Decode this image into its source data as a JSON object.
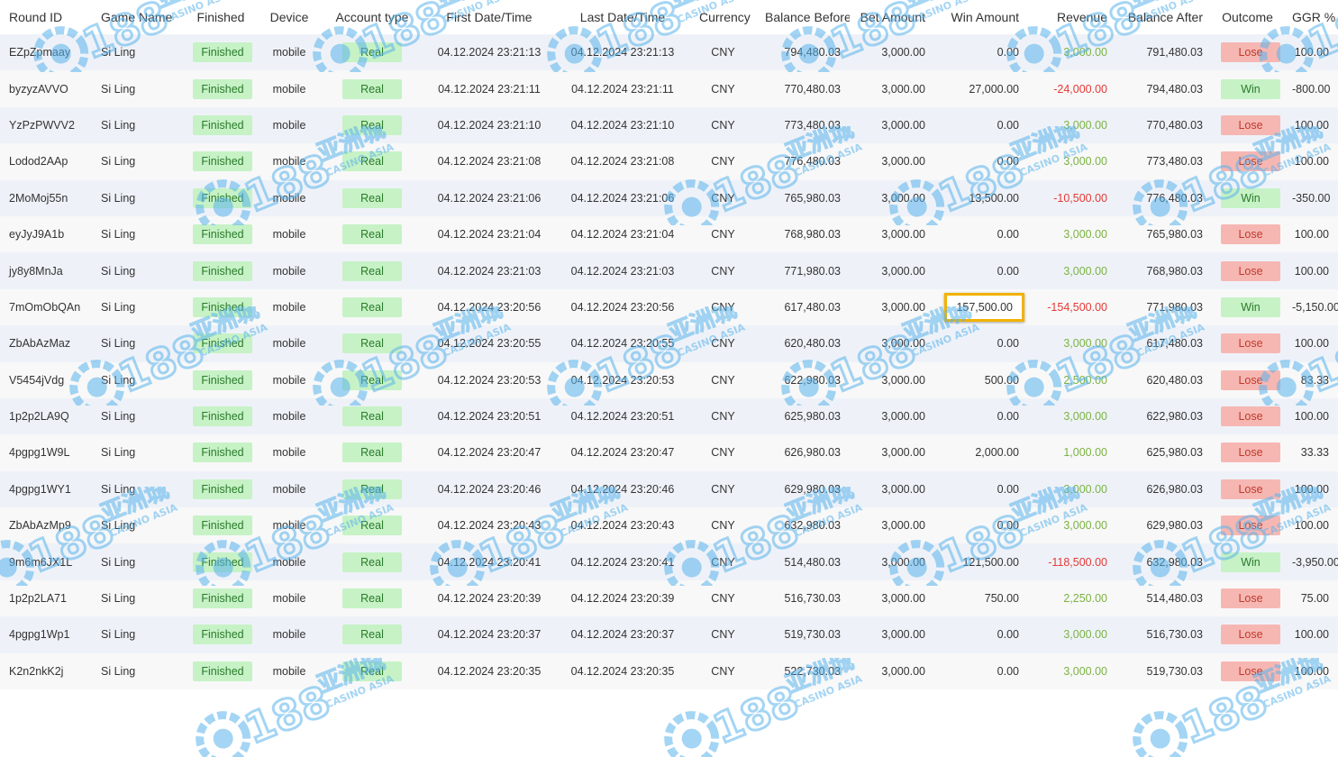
{
  "table": {
    "headers": [
      "Round ID",
      "Game Name",
      "Finished",
      "Device",
      "Account type",
      "First Date/Time",
      "Last Date/Time",
      "Currency",
      "Balance Before",
      "Bet Amount",
      "Win Amount",
      "Revenue",
      "Balance After",
      "Outcome",
      "GGR %"
    ],
    "rows": [
      {
        "round_id": "EZpZpmaay",
        "game": "Si Ling",
        "finished": "Finished",
        "device": "mobile",
        "account_type": "Real",
        "first": "04.12.2024 23:21:13",
        "last": "04.12.2024 23:21:13",
        "currency": "CNY",
        "balance_before": "794,480.03",
        "bet": "3,000.00",
        "win": "0.00",
        "revenue": "3,000.00",
        "balance_after": "791,480.03",
        "outcome": "Lose",
        "ggr": "100.00"
      },
      {
        "round_id": "byzyzAVVO",
        "game": "Si Ling",
        "finished": "Finished",
        "device": "mobile",
        "account_type": "Real",
        "first": "04.12.2024 23:21:11",
        "last": "04.12.2024 23:21:11",
        "currency": "CNY",
        "balance_before": "770,480.03",
        "bet": "3,000.00",
        "win": "27,000.00",
        "revenue": "-24,000.00",
        "balance_after": "794,480.03",
        "outcome": "Win",
        "ggr": "-800.00"
      },
      {
        "round_id": "YzPzPWVV2",
        "game": "Si Ling",
        "finished": "Finished",
        "device": "mobile",
        "account_type": "Real",
        "first": "04.12.2024 23:21:10",
        "last": "04.12.2024 23:21:10",
        "currency": "CNY",
        "balance_before": "773,480.03",
        "bet": "3,000.00",
        "win": "0.00",
        "revenue": "3,000.00",
        "balance_after": "770,480.03",
        "outcome": "Lose",
        "ggr": "100.00"
      },
      {
        "round_id": "Lodod2AAp",
        "game": "Si Ling",
        "finished": "Finished",
        "device": "mobile",
        "account_type": "Real",
        "first": "04.12.2024 23:21:08",
        "last": "04.12.2024 23:21:08",
        "currency": "CNY",
        "balance_before": "776,480.03",
        "bet": "3,000.00",
        "win": "0.00",
        "revenue": "3,000.00",
        "balance_after": "773,480.03",
        "outcome": "Lose",
        "ggr": "100.00"
      },
      {
        "round_id": "2MoMoj55n",
        "game": "Si Ling",
        "finished": "Finished",
        "device": "mobile",
        "account_type": "Real",
        "first": "04.12.2024 23:21:06",
        "last": "04.12.2024 23:21:06",
        "currency": "CNY",
        "balance_before": "765,980.03",
        "bet": "3,000.00",
        "win": "13,500.00",
        "revenue": "-10,500.00",
        "balance_after": "776,480.03",
        "outcome": "Win",
        "ggr": "-350.00"
      },
      {
        "round_id": "eyJyJ9A1b",
        "game": "Si Ling",
        "finished": "Finished",
        "device": "mobile",
        "account_type": "Real",
        "first": "04.12.2024 23:21:04",
        "last": "04.12.2024 23:21:04",
        "currency": "CNY",
        "balance_before": "768,980.03",
        "bet": "3,000.00",
        "win": "0.00",
        "revenue": "3,000.00",
        "balance_after": "765,980.03",
        "outcome": "Lose",
        "ggr": "100.00"
      },
      {
        "round_id": "jy8y8MnJa",
        "game": "Si Ling",
        "finished": "Finished",
        "device": "mobile",
        "account_type": "Real",
        "first": "04.12.2024 23:21:03",
        "last": "04.12.2024 23:21:03",
        "currency": "CNY",
        "balance_before": "771,980.03",
        "bet": "3,000.00",
        "win": "0.00",
        "revenue": "3,000.00",
        "balance_after": "768,980.03",
        "outcome": "Lose",
        "ggr": "100.00"
      },
      {
        "round_id": "7mOmObQAn",
        "game": "Si Ling",
        "finished": "Finished",
        "device": "mobile",
        "account_type": "Real",
        "first": "04.12.2024 23:20:56",
        "last": "04.12.2024 23:20:56",
        "currency": "CNY",
        "balance_before": "617,480.03",
        "bet": "3,000.00",
        "win": "157,500.00",
        "revenue": "-154,500.00",
        "balance_after": "771,980.03",
        "outcome": "Win",
        "ggr": "-5,150.00",
        "highlight_win": true
      },
      {
        "round_id": "ZbAbAzMaz",
        "game": "Si Ling",
        "finished": "Finished",
        "device": "mobile",
        "account_type": "Real",
        "first": "04.12.2024 23:20:55",
        "last": "04.12.2024 23:20:55",
        "currency": "CNY",
        "balance_before": "620,480.03",
        "bet": "3,000.00",
        "win": "0.00",
        "revenue": "3,000.00",
        "balance_after": "617,480.03",
        "outcome": "Lose",
        "ggr": "100.00"
      },
      {
        "round_id": "V5454jVdg",
        "game": "Si Ling",
        "finished": "Finished",
        "device": "mobile",
        "account_type": "Real",
        "first": "04.12.2024 23:20:53",
        "last": "04.12.2024 23:20:53",
        "currency": "CNY",
        "balance_before": "622,980.03",
        "bet": "3,000.00",
        "win": "500.00",
        "revenue": "2,500.00",
        "balance_after": "620,480.03",
        "outcome": "Lose",
        "ggr": "83.33"
      },
      {
        "round_id": "1p2p2LA9Q",
        "game": "Si Ling",
        "finished": "Finished",
        "device": "mobile",
        "account_type": "Real",
        "first": "04.12.2024 23:20:51",
        "last": "04.12.2024 23:20:51",
        "currency": "CNY",
        "balance_before": "625,980.03",
        "bet": "3,000.00",
        "win": "0.00",
        "revenue": "3,000.00",
        "balance_after": "622,980.03",
        "outcome": "Lose",
        "ggr": "100.00"
      },
      {
        "round_id": "4pgpg1W9L",
        "game": "Si Ling",
        "finished": "Finished",
        "device": "mobile",
        "account_type": "Real",
        "first": "04.12.2024 23:20:47",
        "last": "04.12.2024 23:20:47",
        "currency": "CNY",
        "balance_before": "626,980.03",
        "bet": "3,000.00",
        "win": "2,000.00",
        "revenue": "1,000.00",
        "balance_after": "625,980.03",
        "outcome": "Lose",
        "ggr": "33.33"
      },
      {
        "round_id": "4pgpg1WY1",
        "game": "Si Ling",
        "finished": "Finished",
        "device": "mobile",
        "account_type": "Real",
        "first": "04.12.2024 23:20:46",
        "last": "04.12.2024 23:20:46",
        "currency": "CNY",
        "balance_before": "629,980.03",
        "bet": "3,000.00",
        "win": "0.00",
        "revenue": "3,000.00",
        "balance_after": "626,980.03",
        "outcome": "Lose",
        "ggr": "100.00"
      },
      {
        "round_id": "ZbAbAzMp9",
        "game": "Si Ling",
        "finished": "Finished",
        "device": "mobile",
        "account_type": "Real",
        "first": "04.12.2024 23:20:43",
        "last": "04.12.2024 23:20:43",
        "currency": "CNY",
        "balance_before": "632,980.03",
        "bet": "3,000.00",
        "win": "0.00",
        "revenue": "3,000.00",
        "balance_after": "629,980.03",
        "outcome": "Lose",
        "ggr": "100.00"
      },
      {
        "round_id": "9m6m6JX1L",
        "game": "Si Ling",
        "finished": "Finished",
        "device": "mobile",
        "account_type": "Real",
        "first": "04.12.2024 23:20:41",
        "last": "04.12.2024 23:20:41",
        "currency": "CNY",
        "balance_before": "514,480.03",
        "bet": "3,000.00",
        "win": "121,500.00",
        "revenue": "-118,500.00",
        "balance_after": "632,980.03",
        "outcome": "Win",
        "ggr": "-3,950.00"
      },
      {
        "round_id": "1p2p2LA71",
        "game": "Si Ling",
        "finished": "Finished",
        "device": "mobile",
        "account_type": "Real",
        "first": "04.12.2024 23:20:39",
        "last": "04.12.2024 23:20:39",
        "currency": "CNY",
        "balance_before": "516,730.03",
        "bet": "3,000.00",
        "win": "750.00",
        "revenue": "2,250.00",
        "balance_after": "514,480.03",
        "outcome": "Lose",
        "ggr": "75.00"
      },
      {
        "round_id": "4pgpg1Wp1",
        "game": "Si Ling",
        "finished": "Finished",
        "device": "mobile",
        "account_type": "Real",
        "first": "04.12.2024 23:20:37",
        "last": "04.12.2024 23:20:37",
        "currency": "CNY",
        "balance_before": "519,730.03",
        "bet": "3,000.00",
        "win": "0.00",
        "revenue": "3,000.00",
        "balance_after": "516,730.03",
        "outcome": "Lose",
        "ggr": "100.00"
      },
      {
        "round_id": "K2n2nkK2j",
        "game": "Si Ling",
        "finished": "Finished",
        "device": "mobile",
        "account_type": "Real",
        "first": "04.12.2024 23:20:35",
        "last": "04.12.2024 23:20:35",
        "currency": "CNY",
        "balance_before": "522,730.03",
        "bet": "3,000.00",
        "win": "0.00",
        "revenue": "3,000.00",
        "balance_after": "519,730.03",
        "outcome": "Lose",
        "ggr": "100.00"
      }
    ]
  },
  "watermark": {
    "logo": "C@188",
    "text_cn": "亚洲城",
    "text_en": "CASINO ASIA"
  },
  "colors": {
    "pill_green_bg": "#c6f2c6",
    "pill_red_bg": "#f6b7b3",
    "revenue_positive": "#7cb342",
    "revenue_negative": "#e53935",
    "highlight_border": "#f2b200",
    "watermark": "#5ab4ec"
  }
}
